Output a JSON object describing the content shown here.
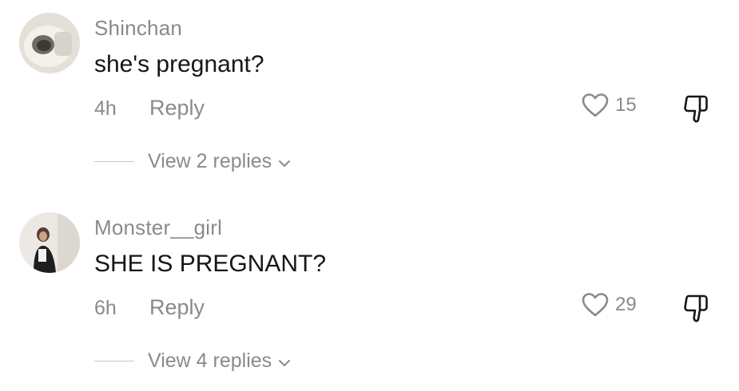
{
  "comments": [
    {
      "username": "Shinchan",
      "text": "she's pregnant?",
      "time": "4h",
      "reply_label": "Reply",
      "likes": "15",
      "view_replies": "View 2 replies",
      "avatar_icon": "photo-avatar"
    },
    {
      "username": "Monster__girl",
      "text": "SHE IS PREGNANT?",
      "time": "6h",
      "reply_label": "Reply",
      "likes": "29",
      "view_replies": "View 4 replies",
      "avatar_icon": "photo-avatar"
    }
  ],
  "icons": {
    "like": "heart-icon",
    "dislike": "thumbs-down-icon",
    "expand": "chevron-down-icon"
  },
  "colors": {
    "text_primary": "#161616",
    "text_secondary": "#8a8a8a",
    "divider": "#c7c7c7",
    "background": "#ffffff"
  }
}
